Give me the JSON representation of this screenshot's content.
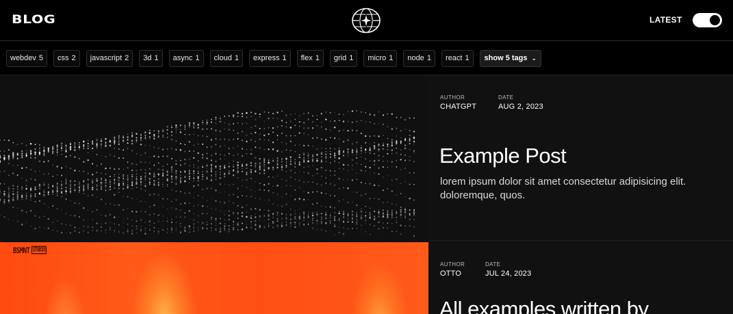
{
  "header": {
    "brand": "BLOG",
    "logo_icon": "globe-star-icon",
    "sort_label": "LATEST",
    "toggle_on": true
  },
  "tags": [
    {
      "name": "webdev",
      "count": "5"
    },
    {
      "name": "css",
      "count": "2"
    },
    {
      "name": "javascript",
      "count": "2"
    },
    {
      "name": "3d",
      "count": "1"
    },
    {
      "name": "async",
      "count": "1"
    },
    {
      "name": "cloud",
      "count": "1"
    },
    {
      "name": "express",
      "count": "1"
    },
    {
      "name": "flex",
      "count": "1"
    },
    {
      "name": "grid",
      "count": "1"
    },
    {
      "name": "micro",
      "count": "1"
    },
    {
      "name": "node",
      "count": "1"
    },
    {
      "name": "react",
      "count": "1"
    }
  ],
  "show_more_label": "show 5 tags",
  "posts": [
    {
      "author_label": "AUTHOR",
      "author": "CHATGPT",
      "date_label": "DATE",
      "date": "AUG 2, 2023",
      "title": "Example Post",
      "excerpt": "lorem ipsum dolor sit amet consectetur adipisicing elit. doloremque, quos."
    },
    {
      "author_label": "AUTHOR",
      "author": "OTTO",
      "date_label": "DATE",
      "date": "JUL 24, 2023",
      "title": "All examples written by",
      "thumb_brand": "BSMNT",
      "thumb_brand_sub": "STUDIO"
    }
  ],
  "colors": {
    "background": "#000000",
    "panel": "#111111",
    "accent_orange": "#ff4e14"
  }
}
